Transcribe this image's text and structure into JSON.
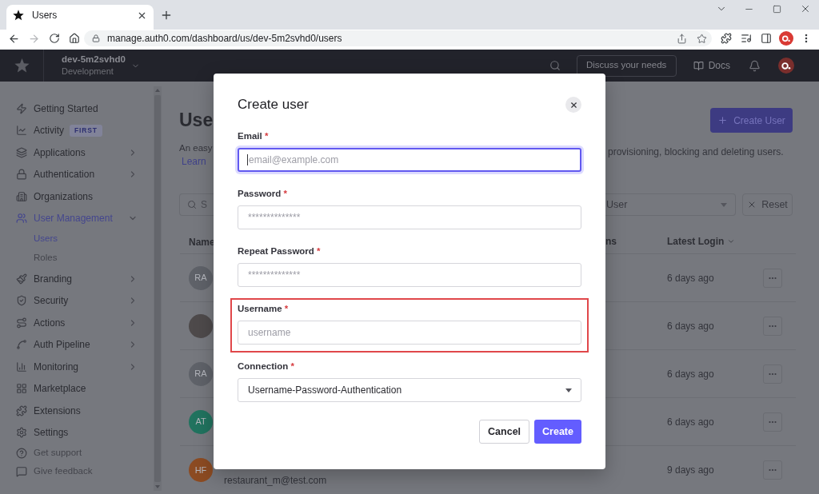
{
  "browser": {
    "tabs": [
      {
        "title": "Users",
        "selected": true
      }
    ],
    "forward_enabled": false,
    "url": "manage.auth0.com/dashboard/us/dev-5m2svhd0/users"
  },
  "header": {
    "tenant": "dev-5m2svhd0",
    "environment": "Development",
    "discuss_button": "Discuss your needs",
    "docs_link": "Docs"
  },
  "sidebar": {
    "items": [
      {
        "kind": "link",
        "label": "Getting Started",
        "selected": false
      },
      {
        "kind": "link",
        "label": "Activity",
        "selected": false,
        "badge": "FIRST"
      },
      {
        "kind": "group",
        "label": "Applications",
        "selected": false,
        "expanded": false
      },
      {
        "kind": "group",
        "label": "Authentication",
        "selected": false,
        "expanded": false
      },
      {
        "kind": "link",
        "label": "Organizations",
        "selected": false
      },
      {
        "kind": "group",
        "label": "User Management",
        "selected": true,
        "expanded": true,
        "children": [
          {
            "label": "Users",
            "selected": true
          },
          {
            "label": "Roles",
            "selected": false
          }
        ]
      },
      {
        "kind": "group",
        "label": "Branding",
        "selected": false,
        "expanded": false
      },
      {
        "kind": "group",
        "label": "Security",
        "selected": false,
        "expanded": false
      },
      {
        "kind": "group",
        "label": "Actions",
        "selected": false,
        "expanded": false
      },
      {
        "kind": "group",
        "label": "Auth Pipeline",
        "selected": false,
        "expanded": false
      },
      {
        "kind": "group",
        "label": "Monitoring",
        "selected": false,
        "expanded": false
      },
      {
        "kind": "link",
        "label": "Marketplace",
        "selected": false
      },
      {
        "kind": "link",
        "label": "Extensions",
        "selected": false
      },
      {
        "kind": "link",
        "label": "Settings",
        "selected": false
      },
      {
        "kind": "footer",
        "label": "Get support",
        "selected": false
      },
      {
        "kind": "footer",
        "label": "Give feedback",
        "selected": false
      }
    ]
  },
  "page": {
    "title": "Use",
    "intro": "An easy",
    "learn_link": "Learn",
    "intro_end": "provisioning, blocking and deleting users.",
    "create_button": "Create User",
    "search": {
      "placeholder": "S"
    },
    "filter": {
      "value": "User"
    },
    "reset_button": "Reset",
    "columns": [
      {
        "label": "Name"
      },
      {
        "label": "ns"
      },
      {
        "label": "Latest Login"
      }
    ],
    "rows": [
      {
        "avatar": {
          "kind": "initials",
          "initials": "RA",
          "color": "#5f6269"
        },
        "latest_login": "6 days ago"
      },
      {
        "avatar": {
          "kind": "photo"
        },
        "latest_login": "6 days ago"
      },
      {
        "avatar": {
          "kind": "initials",
          "initials": "RA",
          "color": "#5f6269"
        },
        "latest_login": "6 days ago"
      },
      {
        "avatar": {
          "kind": "initials",
          "initials": "AT",
          "color": "#21735f"
        },
        "latest_login": "6 days ago"
      },
      {
        "avatar": {
          "kind": "initials",
          "initials": "HF",
          "color": "#8c4b22"
        },
        "email": "restaurant_m@test.com",
        "latest_login": "9 days ago"
      }
    ]
  },
  "modal": {
    "title": "Create user",
    "fields": [
      {
        "kind": "input",
        "label": "Email *",
        "placeholder": "email@example.com",
        "focused": true,
        "highlighted": false
      },
      {
        "kind": "input",
        "label": "Password *",
        "placeholder": "**************",
        "focused": false,
        "highlighted": false
      },
      {
        "kind": "input",
        "label": "Repeat Password *",
        "placeholder": "**************",
        "focused": false,
        "highlighted": false
      },
      {
        "kind": "input",
        "label": "Username *",
        "placeholder": "username",
        "focused": false,
        "highlighted": true
      },
      {
        "kind": "select",
        "label": "Connection *",
        "value": "Username-Password-Authentication",
        "focused": false,
        "highlighted": false
      }
    ],
    "buttons": [
      {
        "kind": "secondary",
        "label": "Cancel"
      },
      {
        "kind": "primary",
        "label": "Create"
      }
    ]
  }
}
